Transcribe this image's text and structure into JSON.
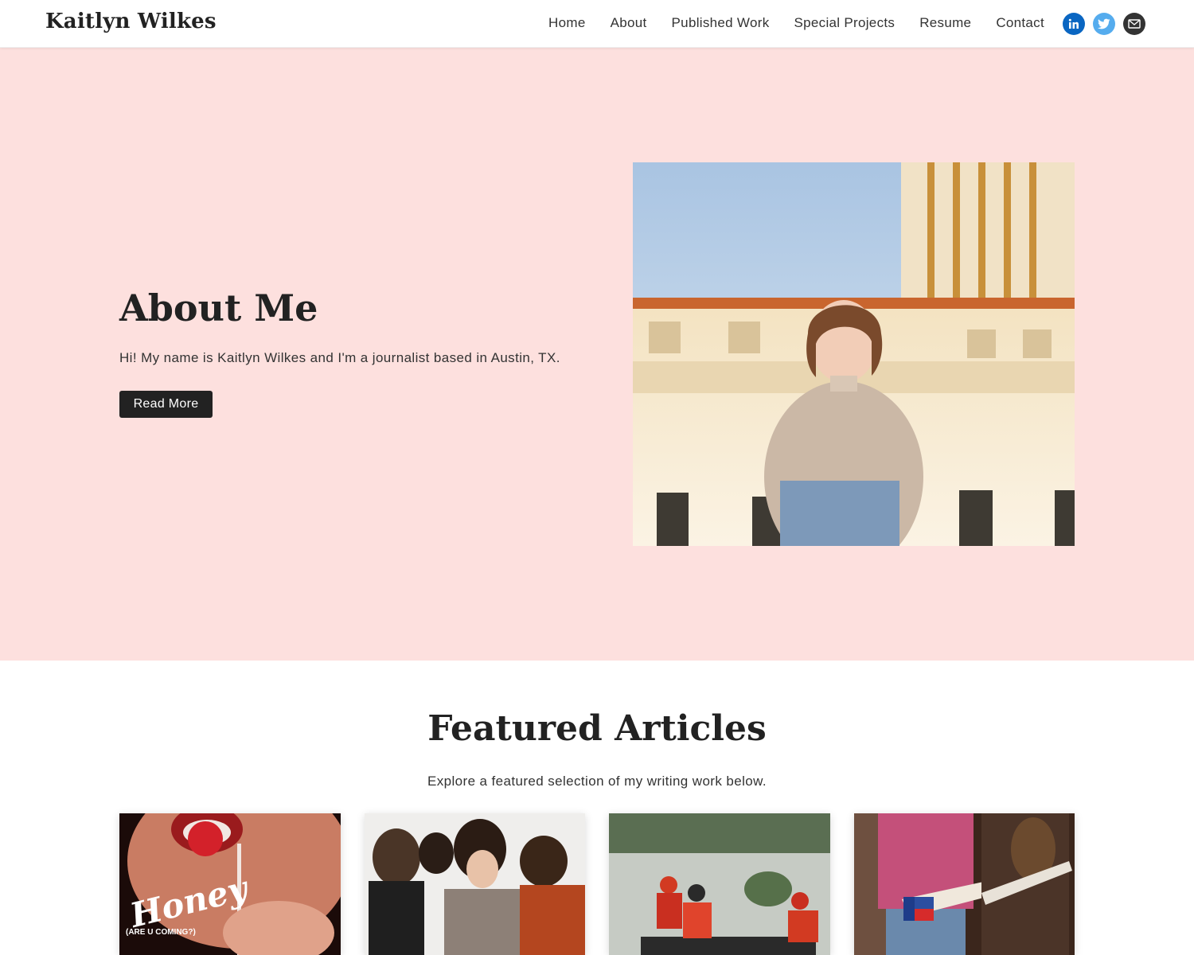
{
  "header": {
    "brand": "Kaitlyn Wilkes",
    "nav": [
      "Home",
      "About",
      "Published Work",
      "Special Projects",
      "Resume",
      "Contact"
    ],
    "socials": [
      {
        "name": "linkedin-icon",
        "color": "#0a66c2"
      },
      {
        "name": "twitter-icon",
        "color": "#55acee"
      },
      {
        "name": "email-icon",
        "color": "#333333"
      }
    ]
  },
  "hero": {
    "title": "About Me",
    "text": "Hi! My name is Kaitlyn Wilkes and I'm a journalist based in Austin, TX.",
    "button": "Read More",
    "background": "#fde0de"
  },
  "featured": {
    "title": "Featured Articles",
    "subtitle": "Explore a featured selection of my writing work below.",
    "cards": [
      {
        "image_text": "Honey",
        "image_subtext": "(ARE U COMING?)"
      },
      {
        "image_text": ""
      },
      {
        "image_text": ""
      },
      {
        "image_text": ""
      }
    ]
  }
}
